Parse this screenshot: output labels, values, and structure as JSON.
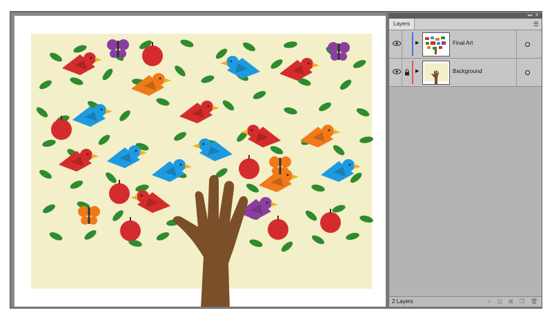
{
  "panel": {
    "tab_label": "Layers",
    "menu_icon": "panel-menu-icon",
    "layer_count": "2 Layers",
    "layers": [
      {
        "name": "Final Art",
        "color": "#4a6cf5",
        "locked": false
      },
      {
        "name": "Background",
        "color": "#e05555",
        "locked": true
      }
    ],
    "footer_icons": [
      "locate-object-icon",
      "make-clipping-mask-icon",
      "new-sublayer-icon",
      "new-layer-icon",
      "delete-layer-icon"
    ]
  },
  "colors": {
    "background": "#f3efc9",
    "hand": "#7a4f2a",
    "leaf": "#2e8b2e",
    "red": "#d42c2c",
    "orange": "#f07a1a",
    "blue": "#1e9be0",
    "purple": "#8a3fa0",
    "yellow": "#f2b21c"
  }
}
